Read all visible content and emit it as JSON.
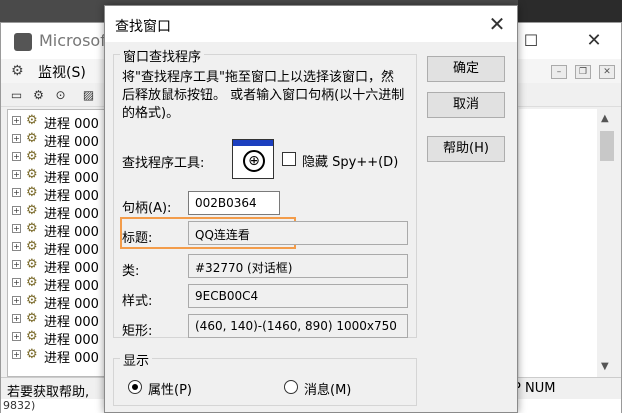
{
  "spy_window": {
    "title": "Microsof",
    "menu_label": "监视(S)",
    "tree_items": [
      "进程 000",
      "进程 000",
      "进程 000",
      "进程 000",
      "进程 000",
      "进程 000",
      "进程 000",
      "进程 000",
      "进程 000",
      "进程 000",
      "进程 000",
      "进程 000",
      "进程 000",
      "进程 000"
    ],
    "status_help": "若要获取帮助,",
    "status_num": "P NUM",
    "bottom_text": "9832)"
  },
  "find_dialog": {
    "title": "查找窗口",
    "group_finder_label": "窗口查找程序",
    "instructions": "将\"查找程序工具\"拖至窗口上以选择该窗口，然后释放鼠标按钮。 或者输入窗口句柄(以十六进制的格式)。",
    "finder_tool_label": "查找程序工具:",
    "hide_spy_label": "隐藏 Spy++(D)",
    "handle_label": "句柄(A):",
    "handle_value": "002B0364",
    "caption_label": "标题:",
    "caption_value": "QQ连连看",
    "class_label": "类:",
    "class_value": "#32770 (对话框)",
    "style_label": "样式:",
    "style_value": "9ECB00C4",
    "rect_label": "矩形:",
    "rect_value": "(460, 140)-(1460, 890) 1000x750",
    "group_display_label": "显示",
    "radio_properties": "属性(P)",
    "radio_messages": "消息(M)",
    "ok_button": "确定",
    "cancel_button": "取消",
    "help_button": "帮助(H)"
  },
  "colors": {
    "highlight_border": "#f39c4a",
    "finder_bar": "#1c3fbf"
  }
}
